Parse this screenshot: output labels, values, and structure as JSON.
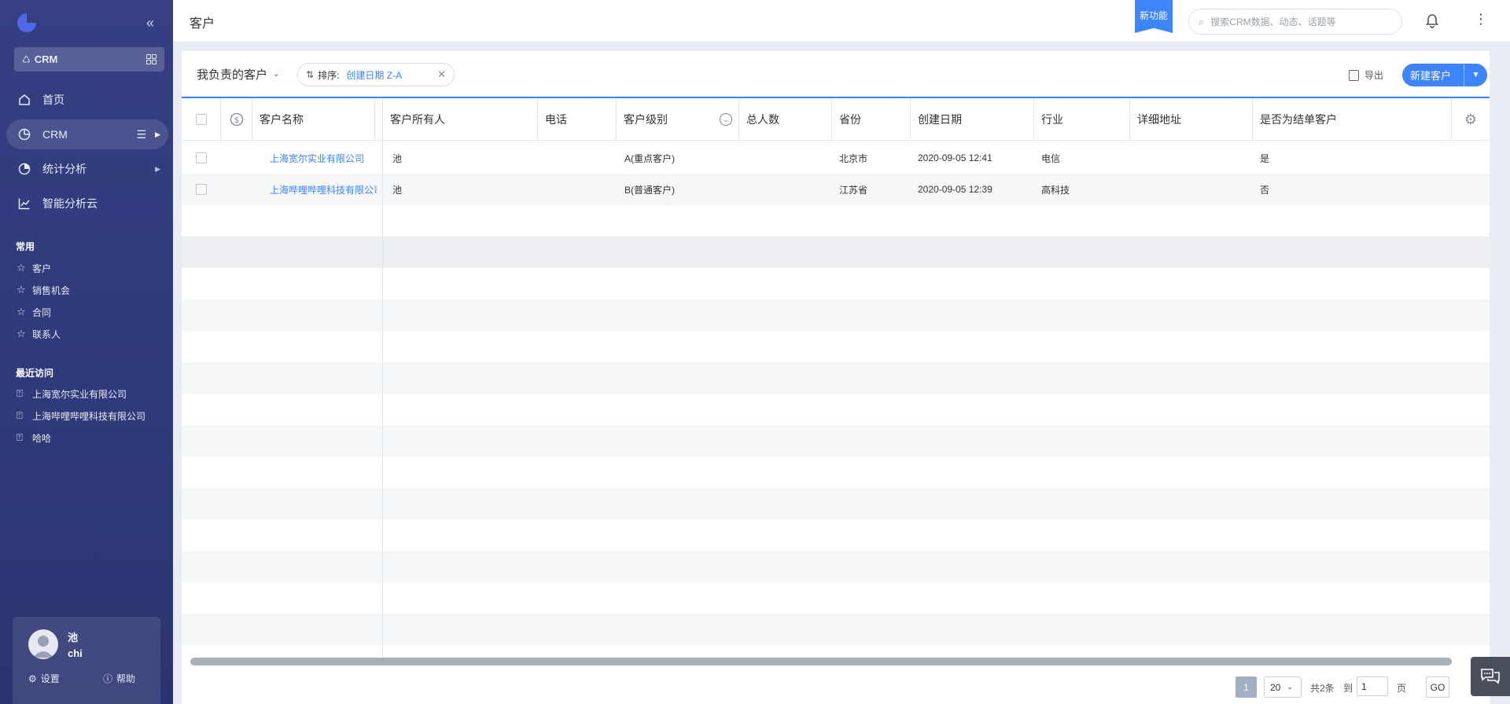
{
  "sidebar": {
    "app_switch_label": "CRM",
    "nav": [
      {
        "label": "首页"
      },
      {
        "label": "CRM"
      },
      {
        "label": "统计分析"
      },
      {
        "label": "智能分析云"
      }
    ],
    "common_title": "常用",
    "favorites": [
      "客户",
      "销售机会",
      "合同",
      "联系人"
    ],
    "recent_title": "最近访问",
    "recent": [
      "上海宽尔实业有限公司",
      "上海哔哩哔哩科技有限公司",
      "哈哈"
    ],
    "user": {
      "name": "池",
      "sub": "chi",
      "settings": "设置",
      "help": "帮助"
    }
  },
  "topbar": {
    "title": "客户",
    "new_feature": "新功能",
    "search_placeholder": "搜索CRM数据、动态、话题等"
  },
  "toolbar": {
    "scene": "我负责的客户",
    "sort_label": "排序:",
    "sort_value": "创建日期 Z-A",
    "export": "导出",
    "new_customer": "新建客户"
  },
  "table": {
    "columns": [
      "客户名称",
      "客户所有人",
      "电话",
      "客户级别",
      "总人数",
      "省份",
      "创建日期",
      "行业",
      "详细地址",
      "是否为结单客户"
    ],
    "rows": [
      {
        "name": "上海宽尔实业有限公司",
        "owner": "池",
        "phone": "",
        "level": "A(重点客户)",
        "headcount": "",
        "province": "北京市",
        "created": "2020-09-05 12:41",
        "industry": "电信",
        "address": "",
        "closed": "是"
      },
      {
        "name": "上海哔哩哔哩科技有限公司",
        "owner": "池",
        "phone": "",
        "level": "B(普通客户)",
        "headcount": "",
        "province": "江苏省",
        "created": "2020-09-05 12:39",
        "industry": "高科技",
        "address": "",
        "closed": "否"
      }
    ]
  },
  "pagination": {
    "current_page": "1",
    "page_size": "20",
    "total": "共2条",
    "goto_label": "到",
    "goto_value": "1",
    "page_unit": "页",
    "go": "GO"
  },
  "colors": {
    "accent": "#3d84ff",
    "sidebar": "#323c7e"
  }
}
